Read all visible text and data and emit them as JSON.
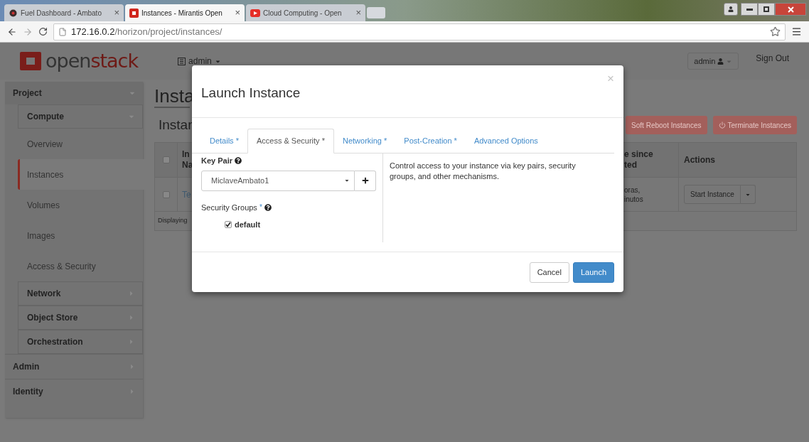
{
  "browser": {
    "tabs": [
      {
        "title": "Fuel Dashboard - Ambato",
        "selected": false,
        "kind": "fuel"
      },
      {
        "title": "Instances - Mirantis Open",
        "selected": true,
        "kind": "openstack"
      },
      {
        "title": "Cloud Computing - Open",
        "selected": false,
        "kind": "video"
      }
    ],
    "close_glyph": "×",
    "url_host": "172.16.0.2",
    "url_path": "/horizon/project/instances/"
  },
  "header": {
    "logo_parts": [
      "open",
      "stack"
    ],
    "project_menu": "admin",
    "user_menu": "admin",
    "sign_out": "Sign Out"
  },
  "sidebar": [
    {
      "label": "Project",
      "expanded": true,
      "children": [
        {
          "label": "Compute",
          "expanded": true,
          "children": [
            {
              "label": "Overview",
              "selected": false
            },
            {
              "label": "Instances",
              "selected": true
            },
            {
              "label": "Volumes",
              "selected": false
            },
            {
              "label": "Images",
              "selected": false
            },
            {
              "label": "Access & Security",
              "selected": false
            }
          ]
        },
        {
          "label": "Network",
          "expanded": false
        },
        {
          "label": "Object Store",
          "expanded": false
        },
        {
          "label": "Orchestration",
          "expanded": false
        }
      ]
    },
    {
      "label": "Admin",
      "expanded": false
    },
    {
      "label": "Identity",
      "expanded": false
    }
  ],
  "page": {
    "title": "Insta",
    "subtitle": "Instar",
    "actions": [
      {
        "label": "Soft Reboot Instances",
        "kind": "plain"
      },
      {
        "label": "Terminate Instances",
        "kind": "power"
      }
    ],
    "table": {
      "all_checked": false,
      "columns": [
        "In\nNa",
        "e since\nted",
        "Actions"
      ],
      "rows": [
        {
          "checked": false,
          "name": "Te",
          "time": "oras,\ninutos",
          "action": "Start Instance"
        }
      ],
      "footer": "Displaying"
    }
  },
  "modal": {
    "title": "Launch Instance",
    "close": "×",
    "tabs": [
      {
        "label": "Details *",
        "selected": false
      },
      {
        "label": "Access & Security *",
        "selected": true
      },
      {
        "label": "Networking *",
        "selected": false
      },
      {
        "label": "Post-Creation *",
        "selected": false
      },
      {
        "label": "Advanced Options",
        "selected": false
      }
    ],
    "key_pair": {
      "label": "Key Pair",
      "value": "MiclaveAmbato1"
    },
    "security_groups": {
      "label": "Security Groups",
      "required": "*",
      "items": [
        {
          "label": "default",
          "checked": true
        }
      ]
    },
    "help": "Control access to your instance via key pairs, security groups, and other mechanisms.",
    "buttons": [
      {
        "label": "Cancel",
        "kind": "secondary"
      },
      {
        "label": "Launch",
        "kind": "primary"
      }
    ]
  }
}
